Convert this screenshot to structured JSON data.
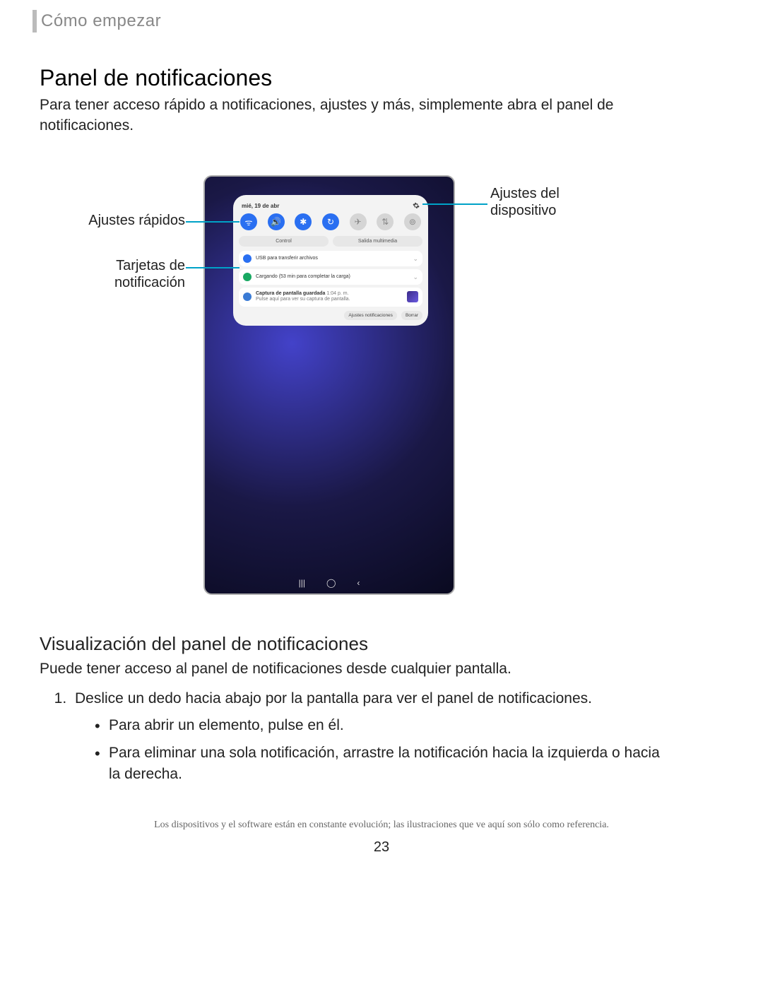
{
  "breadcrumb": "Cómo empezar",
  "h1": "Panel de notificaciones",
  "intro": "Para tener acceso rápido a notificaciones, ajustes y más, simplemente abra el panel de notificaciones.",
  "callouts": {
    "quick_settings": "Ajustes rápidos",
    "notification_cards_l1": "Tarjetas de",
    "notification_cards_l2": "notificación",
    "device_settings_l1": "Ajustes del",
    "device_settings_l2": "dispositivo"
  },
  "panel": {
    "date": "mié, 19 de abr",
    "control": "Control",
    "media": "Salida multimedia",
    "notif1": "USB para transferir archivos",
    "notif2": "Cargando (53 min para completar la carga)",
    "notif3_title": "Captura de pantalla guardada",
    "notif3_time": "1:04 p. m.",
    "notif3_sub": "Pulse aquí para ver su captura de pantalla.",
    "btn_settings": "Ajustes notificaciones",
    "btn_clear": "Borrar"
  },
  "nav": {
    "recent": "|||",
    "home": "◯",
    "back": "‹"
  },
  "h2": "Visualización del panel de notificaciones",
  "p2": "Puede tener acceso al panel de notificaciones desde cualquier pantalla.",
  "step1": "Deslice un dedo hacia abajo por la pantalla para ver el panel de notificaciones.",
  "bullet1": "Para abrir un elemento, pulse en él.",
  "bullet2": "Para eliminar una sola notificación, arrastre la notificación hacia la izquierda o hacia la derecha.",
  "disclaimer": "Los dispositivos y el software están en constante evolución; las ilustraciones que ve aquí son sólo como referencia.",
  "page": "23"
}
